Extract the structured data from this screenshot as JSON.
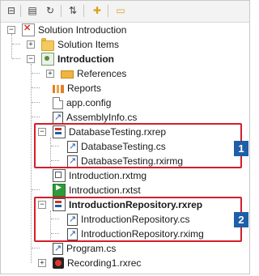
{
  "toolbar": {
    "buttons": [
      {
        "name": "collapse-all-icon",
        "glyph": "⊟"
      },
      {
        "name": "show-all-files-icon",
        "glyph": "▤"
      },
      {
        "name": "refresh-icon",
        "glyph": "↻"
      },
      {
        "name": "sort-icon",
        "glyph": "⇅"
      },
      {
        "name": "add-item-icon",
        "glyph": "✚"
      },
      {
        "name": "open-folder-icon",
        "glyph": "🗁"
      }
    ]
  },
  "tree": {
    "items": [
      {
        "label": "Solution Introduction",
        "icon": "sln",
        "expander": "-"
      },
      {
        "label": "Solution Items",
        "icon": "folder",
        "expander": "+"
      },
      {
        "label": "Introduction",
        "icon": "proj",
        "expander": "-",
        "bold": true
      },
      {
        "label": "References",
        "icon": "refs",
        "expander": "+"
      },
      {
        "label": "Reports",
        "icon": "reports"
      },
      {
        "label": "app.config",
        "icon": "doc"
      },
      {
        "label": "AssemblyInfo.cs",
        "icon": "cs"
      },
      {
        "label": "DatabaseTesting.rxrep",
        "icon": "rxrep",
        "expander": "-"
      },
      {
        "label": "DatabaseTesting.cs",
        "icon": "cs"
      },
      {
        "label": "DatabaseTesting.rxirmg",
        "icon": "cs"
      },
      {
        "label": "Introduction.rxtmg",
        "icon": "rxtmg"
      },
      {
        "label": "Introduction.rxtst",
        "icon": "rxtst"
      },
      {
        "label": "IntroductionRepository.rxrep",
        "icon": "rxrep",
        "expander": "-",
        "bold": true
      },
      {
        "label": "IntroductionRepository.cs",
        "icon": "cs"
      },
      {
        "label": "IntroductionRepository.rximg",
        "icon": "cs"
      },
      {
        "label": "Program.cs",
        "icon": "cs"
      },
      {
        "label": "Recording1.rxrec",
        "icon": "rxrec",
        "expander": "+"
      }
    ]
  },
  "callouts": [
    {
      "label": "1",
      "color": "#1f5fa8"
    },
    {
      "label": "2",
      "color": "#1f5fa8"
    }
  ],
  "colors": {
    "highlight_border": "#d21f2b",
    "badge": "#1f5fa8"
  }
}
